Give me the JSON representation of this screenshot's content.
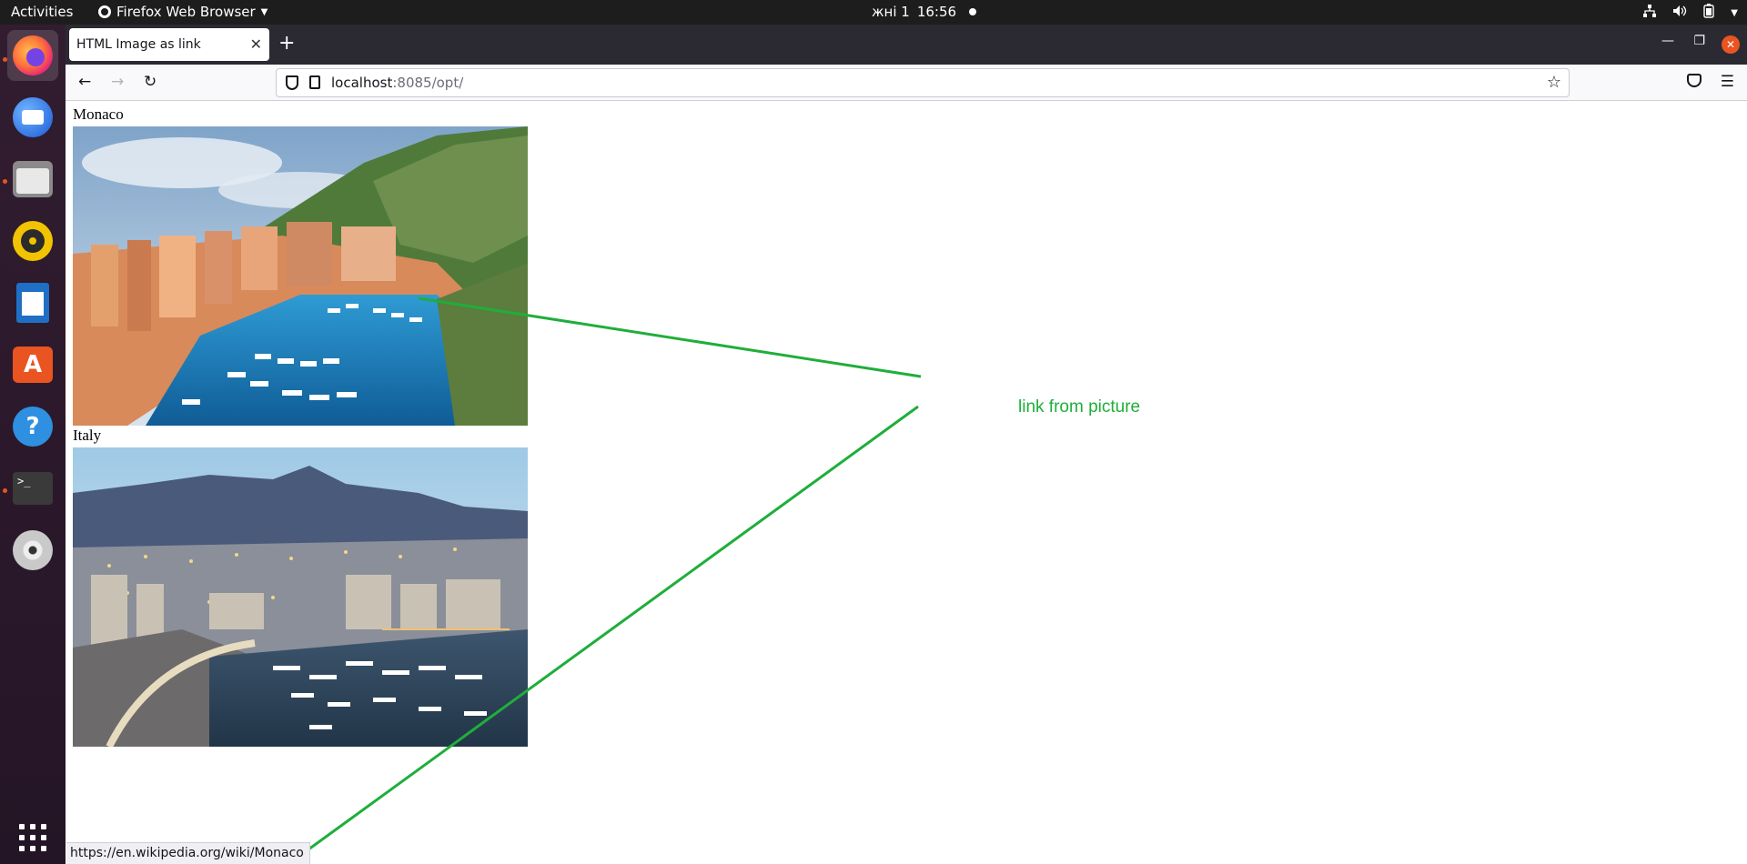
{
  "system": {
    "activities": "Activities",
    "app_menu": "Firefox Web Browser",
    "date": "жні 1",
    "time": "16:56"
  },
  "browser": {
    "tab_title": "HTML Image as link",
    "url_host": "localhost",
    "url_rest": ":8085/opt/",
    "status_link": "https://en.wikipedia.org/wiki/Monaco"
  },
  "page": {
    "items": [
      {
        "caption": "Monaco",
        "image_name": "monaco-harbor-day-photo"
      },
      {
        "caption": "Italy",
        "image_name": "monaco-harbor-dusk-photo"
      }
    ]
  },
  "annotation": {
    "text": "link from picture",
    "color": "#1fae3a"
  },
  "dock": {
    "items": [
      "firefox-icon",
      "thunderbird-icon",
      "files-icon",
      "rhythmbox-icon",
      "writer-icon",
      "software-icon",
      "help-icon",
      "terminal-icon",
      "disc-icon",
      "app-grid-icon"
    ]
  }
}
